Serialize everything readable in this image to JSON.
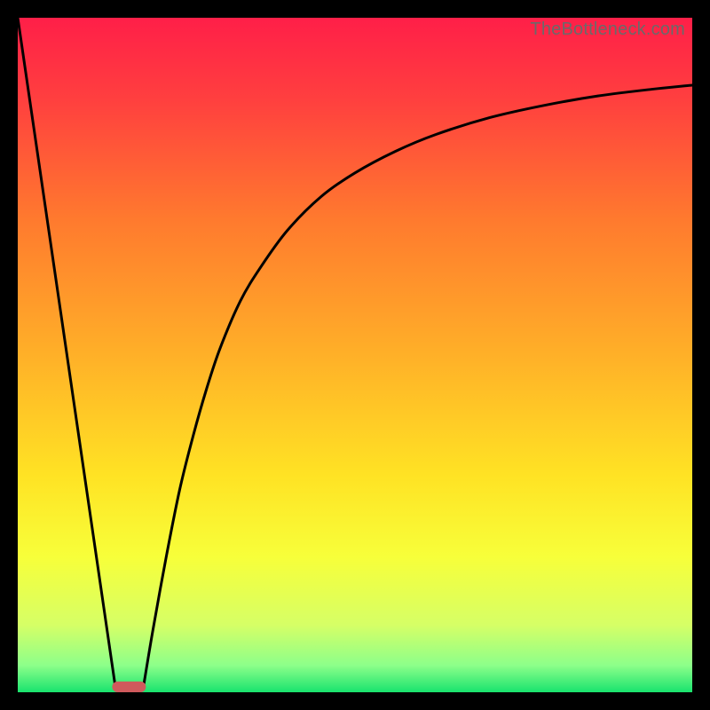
{
  "watermark": "TheBottleneck.com",
  "chart_data": {
    "type": "line",
    "title": "",
    "xlabel": "",
    "ylabel": "",
    "xlim": [
      0,
      100
    ],
    "ylim": [
      0,
      100
    ],
    "background": {
      "type": "vertical-gradient",
      "stops": [
        {
          "pos": 0.0,
          "color": "#ff1f48"
        },
        {
          "pos": 0.12,
          "color": "#ff3f3f"
        },
        {
          "pos": 0.3,
          "color": "#ff7a2e"
        },
        {
          "pos": 0.5,
          "color": "#ffb028"
        },
        {
          "pos": 0.68,
          "color": "#ffe324"
        },
        {
          "pos": 0.8,
          "color": "#f7ff3a"
        },
        {
          "pos": 0.9,
          "color": "#d6ff66"
        },
        {
          "pos": 0.96,
          "color": "#8dff8a"
        },
        {
          "pos": 1.0,
          "color": "#19e36e"
        }
      ]
    },
    "marker": {
      "x": 16.5,
      "y": 0.8,
      "width": 5,
      "height": 1.6,
      "color": "#cf5a5c",
      "shape": "rounded-rect"
    },
    "series": [
      {
        "name": "left-descent",
        "type": "polyline",
        "x": [
          0.0,
          14.5
        ],
        "y": [
          100.0,
          0.6
        ]
      },
      {
        "name": "right-ascent",
        "type": "curve",
        "x": [
          18.6,
          20,
          22,
          24,
          26,
          28,
          30,
          33,
          36,
          40,
          45,
          50,
          56,
          62,
          70,
          78,
          86,
          94,
          100
        ],
        "y": [
          0.6,
          9,
          20,
          30,
          38,
          45,
          51,
          58,
          63,
          68.5,
          73.5,
          77,
          80.2,
          82.7,
          85.2,
          87.0,
          88.4,
          89.4,
          90.0
        ]
      }
    ]
  }
}
